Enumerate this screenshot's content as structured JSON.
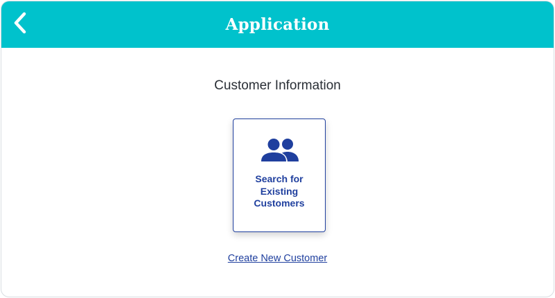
{
  "header": {
    "title": "Application",
    "background_color": "#00c2cc",
    "back_icon": "chevron-left-icon"
  },
  "main": {
    "heading": "Customer Information",
    "search_card": {
      "icon": "people-icon",
      "label": "Search for Existing Customers",
      "accent_color": "#1f3f9e"
    },
    "create_link": "Create New Customer"
  }
}
